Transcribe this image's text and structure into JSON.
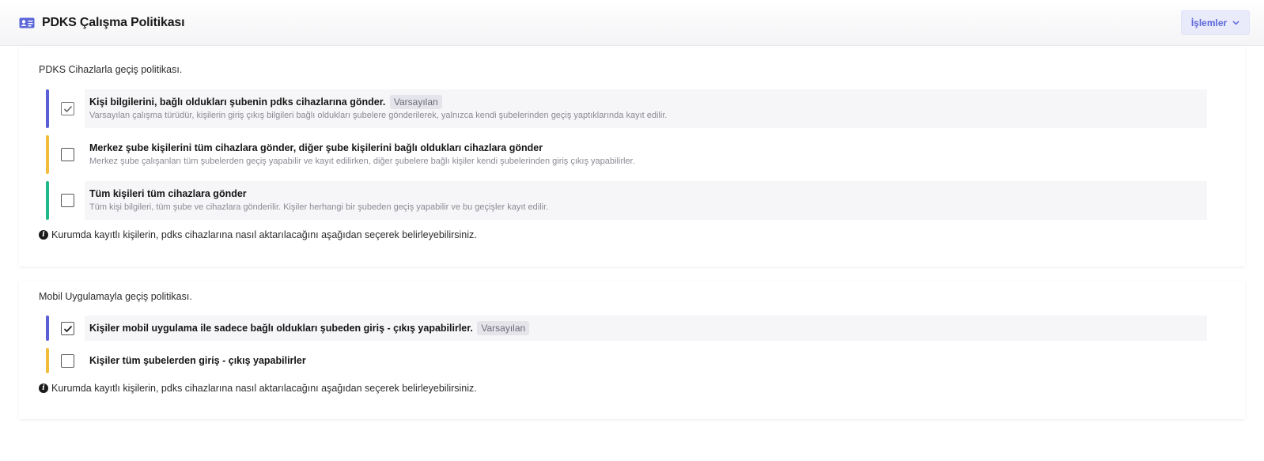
{
  "header": {
    "title": "PDKS Çalışma Politikası",
    "icon": "id-card-icon",
    "actions_label": "İşlemler"
  },
  "colors": {
    "accent": "#5b66d8",
    "bar_blue": "#5b5fd6",
    "bar_yellow": "#f2bd3a",
    "bar_green": "#1fb88a"
  },
  "device_policy": {
    "title": "PDKS Cihazlarla geçiş politikası.",
    "options": [
      {
        "label": "Kişi bilgilerini, bağlı oldukları şubenin pdks cihazlarına gönder.",
        "badge": "Varsayılan",
        "description": "Varsayılan çalışma türüdür, kişilerin giriş çıkış bilgileri bağlı oldukları şubelere gönderilerek, yalnızca kendi şubelerinden geçiş yaptıklarında kayıt edilir.",
        "checked": true
      },
      {
        "label": "Merkez şube kişilerini tüm cihazlara gönder, diğer şube kişilerini bağlı oldukları cihazlara gönder",
        "description": "Merkez şube çalışanları tüm şubelerden geçiş yapabilir ve kayıt edilirken, diğer şubelere bağlı kişiler kendi şubelerinden giriş çıkış yapabilirler.",
        "checked": false
      },
      {
        "label": "Tüm kişileri tüm cihazlara gönder",
        "description": "Tüm kişi bilgileri, tüm şube ve cihazlara gönderilir. Kişiler herhangi bir şubeden geçiş yapabilir ve bu geçişler kayıt edilir.",
        "checked": false
      }
    ],
    "info": "Kurumda kayıtlı kişilerin, pdks cihazlarına nasıl aktarılacağını aşağıdan seçerek belirleyebilirsiniz."
  },
  "mobile_policy": {
    "title": "Mobil Uygulamayla geçiş politikası.",
    "options": [
      {
        "label": "Kişiler mobil uygulama ile sadece bağlı oldukları şubeden giriş - çıkış yapabilirler.",
        "badge": "Varsayılan",
        "checked": true
      },
      {
        "label": "Kişiler tüm şubelerden giriş - çıkış yapabilirler",
        "checked": false
      }
    ],
    "info": "Kurumda kayıtlı kişilerin, pdks cihazlarına nasıl aktarılacağını aşağıdan seçerek belirleyebilirsiniz."
  }
}
